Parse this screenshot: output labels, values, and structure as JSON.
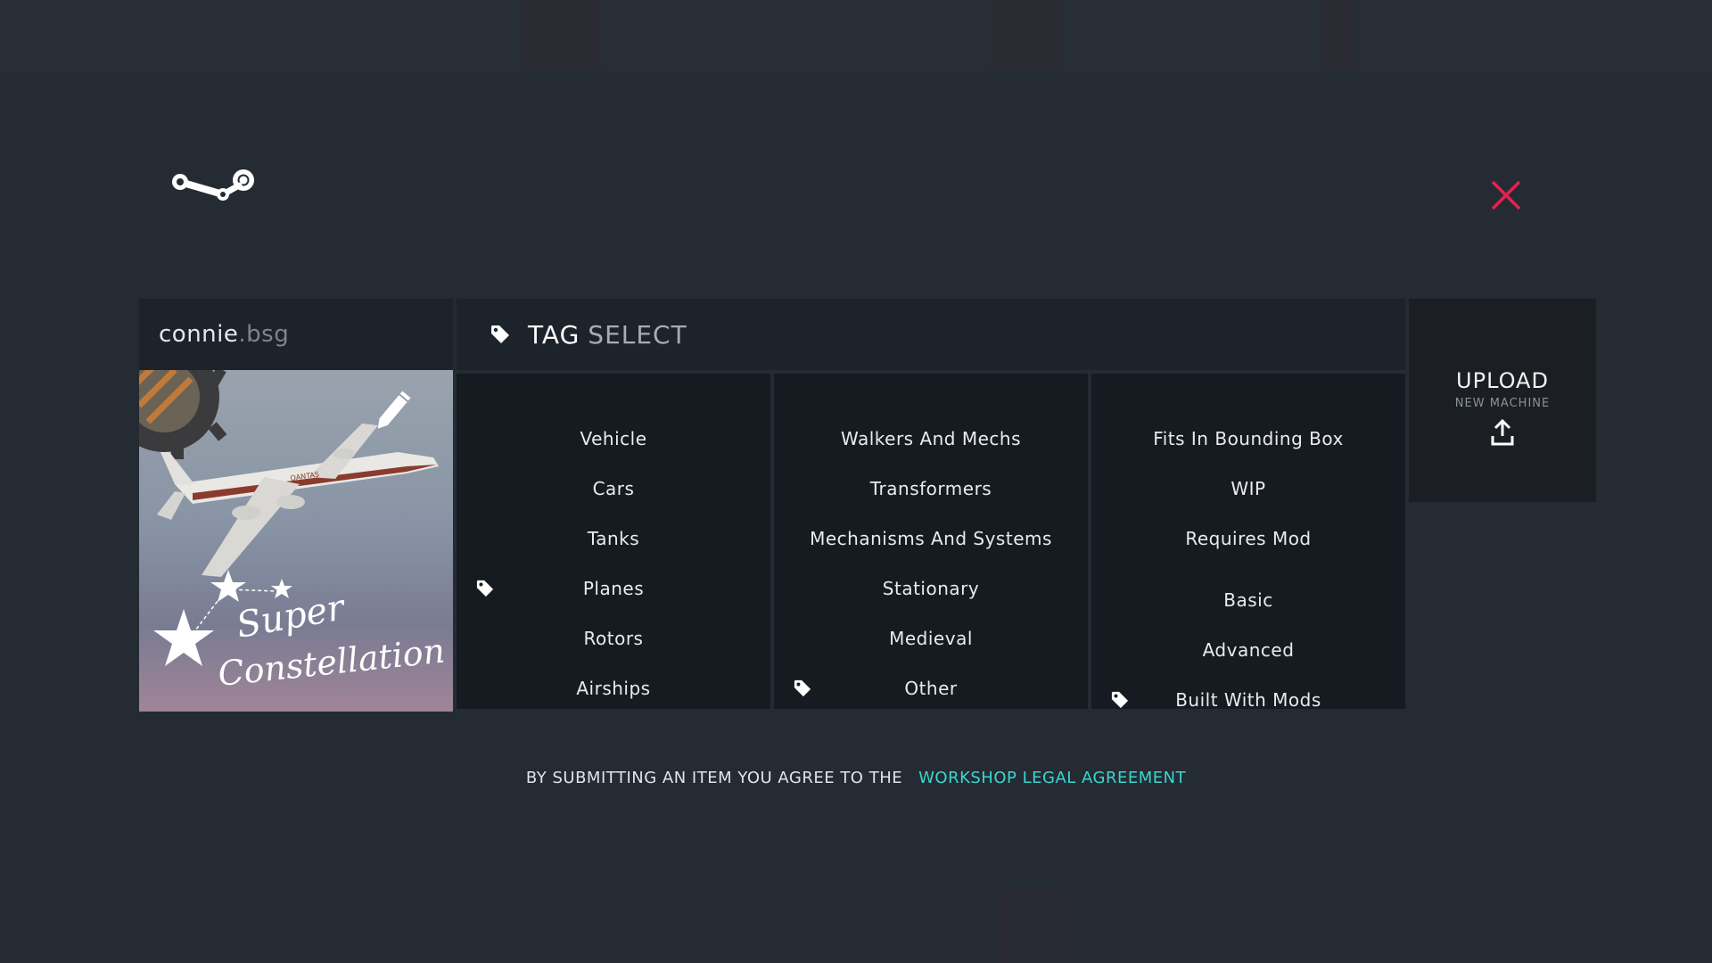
{
  "colors": {
    "accent": "#3ad6d0",
    "close": "#e8204f",
    "panel": "#1d232b",
    "tag_column": "#161b21"
  },
  "header": {
    "logo_icon": "steam-logo-icon",
    "close_icon": "close-x-icon"
  },
  "machine": {
    "name": "connie",
    "extension": ".bsg",
    "thumbnail_text_line1": "Super",
    "thumbnail_text_line2": "Constellation",
    "thumbnail_plane_marking": "QANTAS",
    "edit_icon": "pencil-edit-icon"
  },
  "tag_select": {
    "icon": "tag-icon",
    "title_strong": "TAG",
    "title_soft": "SELECT"
  },
  "tag_columns": [
    {
      "items": [
        {
          "label": "Vehicle",
          "selected": false
        },
        {
          "label": "Cars",
          "selected": false
        },
        {
          "label": "Tanks",
          "selected": false
        },
        {
          "label": "Planes",
          "selected": true
        },
        {
          "label": "Rotors",
          "selected": false
        },
        {
          "label": "Airships",
          "selected": false
        }
      ]
    },
    {
      "items": [
        {
          "label": "Walkers And Mechs",
          "selected": false
        },
        {
          "label": "Transformers",
          "selected": false
        },
        {
          "label": "Mechanisms And Systems",
          "selected": false
        },
        {
          "label": "Stationary",
          "selected": false
        },
        {
          "label": "Medieval",
          "selected": false
        },
        {
          "label": "Other",
          "selected": true
        }
      ]
    },
    {
      "items": [
        {
          "label": "Fits In Bounding Box",
          "selected": false
        },
        {
          "label": "WIP",
          "selected": false
        },
        {
          "label": "Requires Mod",
          "selected": false
        },
        {
          "label": "Basic",
          "selected": false
        },
        {
          "label": "Advanced",
          "selected": false
        },
        {
          "label": "Built With Mods",
          "selected": true
        }
      ]
    }
  ],
  "upload": {
    "title": "UPLOAD",
    "subtitle": "NEW MACHINE",
    "icon": "upload-arrow-icon"
  },
  "legal": {
    "prefix": "BY SUBMITTING AN ITEM YOU AGREE TO THE",
    "link_text": "WORKSHOP LEGAL AGREEMENT"
  }
}
